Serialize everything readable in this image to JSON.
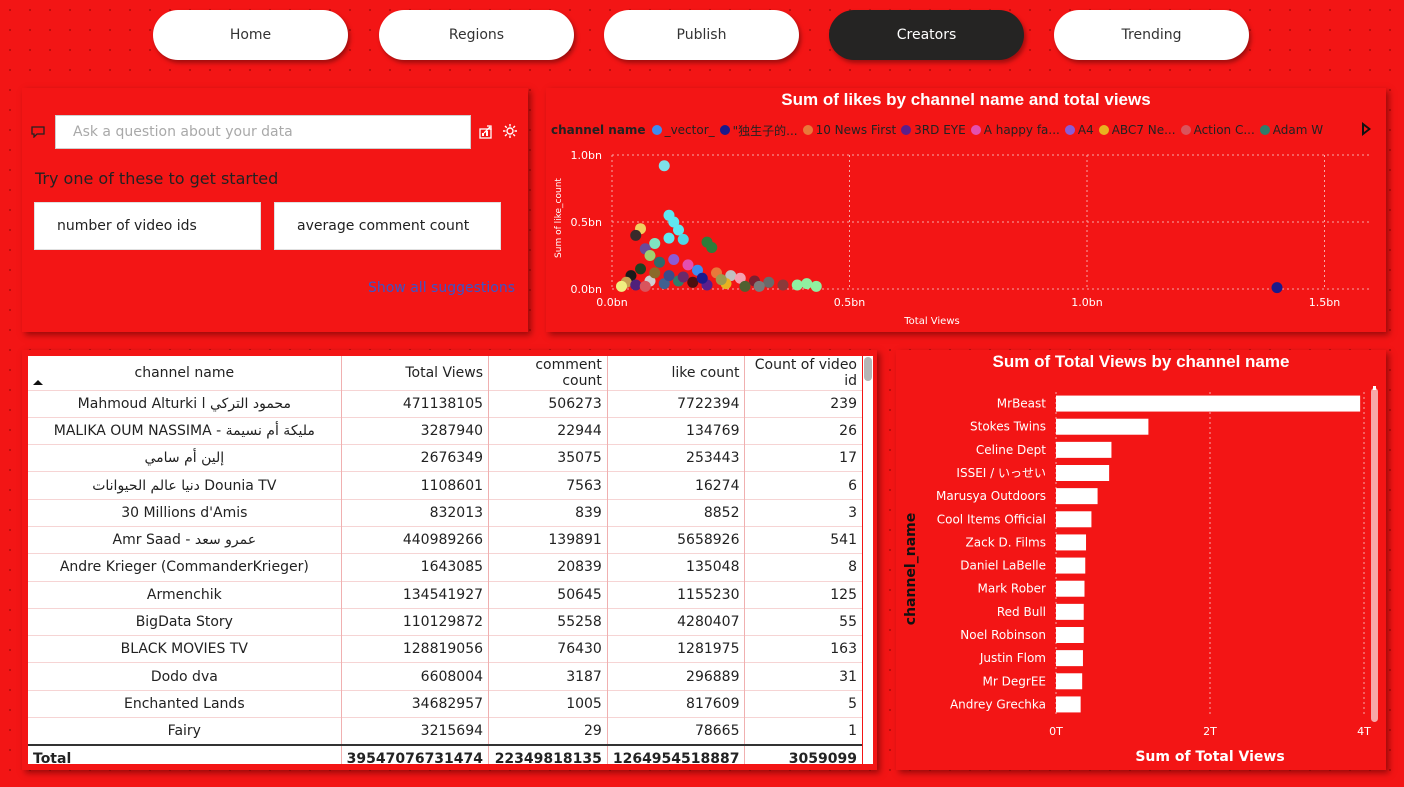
{
  "nav": {
    "home": "Home",
    "regions": "Regions",
    "publish": "Publish",
    "creators": "Creators",
    "trending": "Trending"
  },
  "qa": {
    "placeholder": "Ask a question about your data",
    "hint": "Try one of these to get started",
    "suggestion_1": "number of video ids",
    "suggestion_2": "average comment count",
    "show_all": "Show all suggestions"
  },
  "scatter": {
    "title": "Sum of likes by channel name and total views",
    "legend_title": "channel name",
    "legend": [
      {
        "label": "_vector_",
        "color": "#3d8df0"
      },
      {
        "label": "\"独生子的...",
        "color": "#1a1a8c"
      },
      {
        "label": "10 News First",
        "color": "#e8783a"
      },
      {
        "label": "3RD EYE",
        "color": "#5b1f8c"
      },
      {
        "label": "A happy fa...",
        "color": "#e44fb0"
      },
      {
        "label": "A4",
        "color": "#8a5cd6"
      },
      {
        "label": "ABC7 Ne...",
        "color": "#e9b21f"
      },
      {
        "label": "Action C...",
        "color": "#d9545c"
      },
      {
        "label": "Adam W",
        "color": "#2e7d6a"
      }
    ],
    "chart_data": {
      "type": "scatter",
      "title": "Sum of likes by channel name and total views",
      "xlabel": "Total Views",
      "ylabel": "Sum of like_count",
      "xlim": [
        0,
        1.6
      ],
      "ylim": [
        0,
        1.0
      ],
      "x_ticks": [
        "0.0bn",
        "0.5bn",
        "1.0bn",
        "1.5bn"
      ],
      "y_ticks": [
        "0.0bn",
        "0.5bn",
        "1.0bn"
      ],
      "points": [
        {
          "x": 0.11,
          "y": 0.92,
          "color": "#7ee0ea"
        },
        {
          "x": 0.12,
          "y": 0.55,
          "color": "#5fe8f0"
        },
        {
          "x": 0.13,
          "y": 0.5,
          "color": "#5fe8f0"
        },
        {
          "x": 0.14,
          "y": 0.44,
          "color": "#5fe8f0"
        },
        {
          "x": 0.12,
          "y": 0.38,
          "color": "#5fe8f0"
        },
        {
          "x": 0.15,
          "y": 0.37,
          "color": "#4fd8e6"
        },
        {
          "x": 0.09,
          "y": 0.34,
          "color": "#7fe4c0"
        },
        {
          "x": 0.2,
          "y": 0.35,
          "color": "#2e7d3a"
        },
        {
          "x": 0.21,
          "y": 0.31,
          "color": "#2e7d3a"
        },
        {
          "x": 0.06,
          "y": 0.45,
          "color": "#f0d060"
        },
        {
          "x": 0.05,
          "y": 0.4,
          "color": "#3a2a2a"
        },
        {
          "x": 0.07,
          "y": 0.3,
          "color": "#6a4a9a"
        },
        {
          "x": 0.08,
          "y": 0.25,
          "color": "#a0d070"
        },
        {
          "x": 0.1,
          "y": 0.2,
          "color": "#2d6b6b"
        },
        {
          "x": 0.13,
          "y": 0.22,
          "color": "#8a5cd6"
        },
        {
          "x": 0.16,
          "y": 0.18,
          "color": "#e44fb0"
        },
        {
          "x": 0.18,
          "y": 0.14,
          "color": "#3d8df0"
        },
        {
          "x": 0.22,
          "y": 0.12,
          "color": "#e8783a"
        },
        {
          "x": 0.25,
          "y": 0.1,
          "color": "#c0c0c0"
        },
        {
          "x": 0.27,
          "y": 0.08,
          "color": "#f4a0b0"
        },
        {
          "x": 0.3,
          "y": 0.06,
          "color": "#7a2030"
        },
        {
          "x": 0.33,
          "y": 0.05,
          "color": "#6a6a6a"
        },
        {
          "x": 0.36,
          "y": 0.03,
          "color": "#8a3a3a"
        },
        {
          "x": 0.39,
          "y": 0.03,
          "color": "#90f0a0"
        },
        {
          "x": 0.41,
          "y": 0.04,
          "color": "#90f0a0"
        },
        {
          "x": 0.43,
          "y": 0.02,
          "color": "#90f0a0"
        },
        {
          "x": 0.04,
          "y": 0.1,
          "color": "#1a1a1a"
        },
        {
          "x": 0.03,
          "y": 0.05,
          "color": "#c8a050"
        },
        {
          "x": 0.05,
          "y": 0.03,
          "color": "#50207a"
        },
        {
          "x": 0.08,
          "y": 0.06,
          "color": "#d0d0d0"
        },
        {
          "x": 0.11,
          "y": 0.04,
          "color": "#406090"
        },
        {
          "x": 0.14,
          "y": 0.06,
          "color": "#2e7d6a"
        },
        {
          "x": 0.17,
          "y": 0.05,
          "color": "#4a1010"
        },
        {
          "x": 0.2,
          "y": 0.03,
          "color": "#5b1f8c"
        },
        {
          "x": 0.24,
          "y": 0.04,
          "color": "#e9b21f"
        },
        {
          "x": 0.28,
          "y": 0.02,
          "color": "#506030"
        },
        {
          "x": 0.31,
          "y": 0.02,
          "color": "#7a7a7a"
        },
        {
          "x": 0.06,
          "y": 0.15,
          "color": "#204020"
        },
        {
          "x": 0.09,
          "y": 0.12,
          "color": "#8a6a2a"
        },
        {
          "x": 0.12,
          "y": 0.1,
          "color": "#3a4a8a"
        },
        {
          "x": 0.15,
          "y": 0.09,
          "color": "#6a2a6a"
        },
        {
          "x": 0.19,
          "y": 0.08,
          "color": "#1a1a8c"
        },
        {
          "x": 0.23,
          "y": 0.07,
          "color": "#9a9a50"
        },
        {
          "x": 0.02,
          "y": 0.02,
          "color": "#f0f080"
        },
        {
          "x": 0.07,
          "y": 0.02,
          "color": "#d9545c"
        },
        {
          "x": 1.4,
          "y": 0.01,
          "color": "#1a1a8c"
        }
      ]
    }
  },
  "table": {
    "headers": [
      "channel name",
      "Total Views",
      "comment count",
      "like count",
      "Count of video id"
    ],
    "rows": [
      [
        "Mahmoud Alturki l محمود التركي",
        "471138105",
        "506273",
        "7722394",
        "239"
      ],
      [
        "MALIKA OUM NASSIMA - مليكة أم نسيمة",
        "3287940",
        "22944",
        "134769",
        "26"
      ],
      [
        "إلين أم سامي",
        "2676349",
        "35075",
        "253443",
        "17"
      ],
      [
        "دنيا عالم الحيوانات Dounia TV",
        "1108601",
        "7563",
        "16274",
        "6"
      ],
      [
        "30 Millions d'Amis",
        "832013",
        "839",
        "8852",
        "3"
      ],
      [
        "Amr Saad - عمرو سعد",
        "440989266",
        "139891",
        "5658926",
        "541"
      ],
      [
        "Andre Krieger (CommanderKrieger)",
        "1643085",
        "20839",
        "135048",
        "8"
      ],
      [
        "Armenchik",
        "134541927",
        "50645",
        "1155230",
        "125"
      ],
      [
        "BigData Story",
        "110129872",
        "55258",
        "4280407",
        "55"
      ],
      [
        "BLACK MOVIES TV",
        "128819056",
        "76430",
        "1281975",
        "163"
      ],
      [
        "Dodo dva",
        "6608004",
        "3187",
        "296889",
        "31"
      ],
      [
        "Enchanted Lands",
        "34682957",
        "1005",
        "817609",
        "5"
      ],
      [
        "Fairy",
        "3215694",
        "29",
        "78665",
        "1"
      ]
    ],
    "total": [
      "Total",
      "39547076731474",
      "22349818135",
      "1264954518887",
      "3059099"
    ]
  },
  "bar": {
    "title": "Sum of Total Views by channel name",
    "chart_data": {
      "type": "bar",
      "orientation": "horizontal",
      "title": "Sum of Total Views by channel name",
      "xlabel": "Sum of Total Views",
      "ylabel": "channel_name",
      "x_ticks": [
        "0T",
        "2T",
        "4T"
      ],
      "xlim": [
        0,
        4
      ],
      "categories": [
        "MrBeast",
        "Stokes Twins",
        "Celine Dept",
        "ISSEI / いっせい",
        "Marusya Outdoors",
        "Cool Items Official",
        "Zack D. Films",
        "Daniel LaBelle",
        "Mark Rober",
        "Red Bull",
        "Noel Robinson",
        "Justin Flom",
        "Mr DegrEE",
        "Andrey Grechka"
      ],
      "values": [
        3.95,
        1.2,
        0.72,
        0.69,
        0.54,
        0.46,
        0.39,
        0.38,
        0.37,
        0.36,
        0.36,
        0.35,
        0.34,
        0.32
      ]
    }
  }
}
